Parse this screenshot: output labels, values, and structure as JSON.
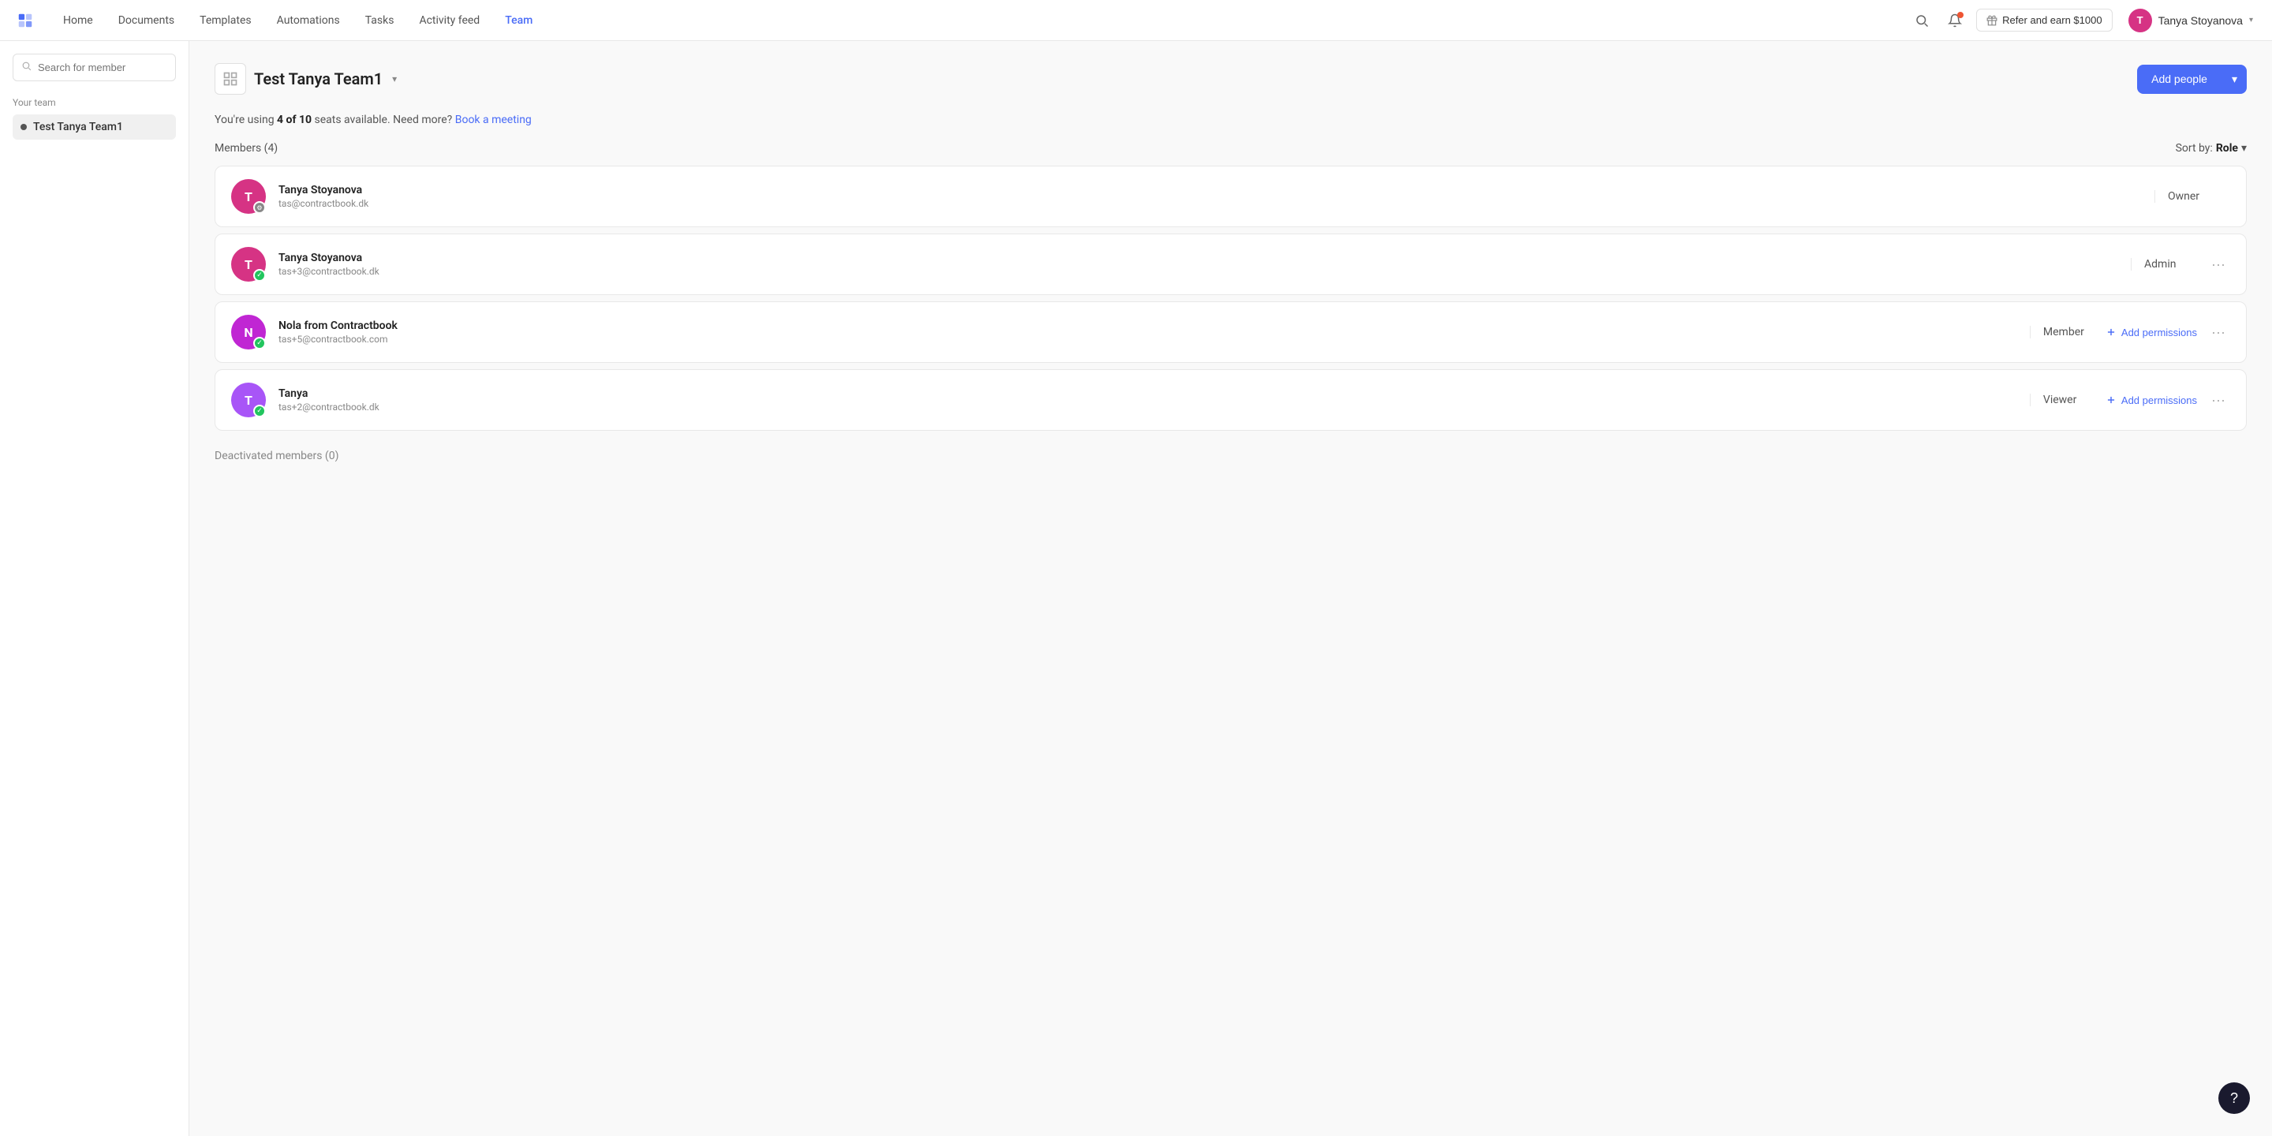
{
  "nav": {
    "links": [
      {
        "label": "Home",
        "active": false
      },
      {
        "label": "Documents",
        "active": false
      },
      {
        "label": "Templates",
        "active": false
      },
      {
        "label": "Automations",
        "active": false
      },
      {
        "label": "Tasks",
        "active": false
      },
      {
        "label": "Activity feed",
        "active": false
      },
      {
        "label": "Team",
        "active": true
      }
    ],
    "refer_label": "Refer and earn $1000",
    "user_name": "Tanya Stoyanova",
    "user_initials": "T"
  },
  "sidebar": {
    "search_placeholder": "Search for member",
    "section_label": "Your team",
    "teams": [
      {
        "label": "Test Tanya Team1",
        "active": true
      }
    ]
  },
  "main": {
    "team_name": "Test Tanya Team1",
    "add_people_label": "Add people",
    "seats_text_prefix": "You're using ",
    "seats_bold": "4 of 10",
    "seats_text_suffix": " seats available. Need more?",
    "book_meeting_label": "Book a meeting",
    "members_label": "Members (4)",
    "sort_prefix": "Sort by: ",
    "sort_value": "Role",
    "members": [
      {
        "name": "Tanya Stoyanova",
        "email": "tas@contractbook.dk",
        "role": "Owner",
        "initials": "T",
        "avatar_color": "#d63384",
        "badge_type": "shield",
        "show_actions": false
      },
      {
        "name": "Tanya Stoyanova",
        "email": "tas+3@contractbook.dk",
        "role": "Admin",
        "initials": "T",
        "avatar_color": "#d63384",
        "badge_type": "check",
        "show_actions": true,
        "show_add_perm": false
      },
      {
        "name": "Nola from Contractbook",
        "email": "tas+5@contractbook.com",
        "role": "Member",
        "initials": "N",
        "avatar_color": "#c026d3",
        "badge_type": "check",
        "show_actions": true,
        "show_add_perm": true,
        "add_perm_label": "Add permissions"
      },
      {
        "name": "Tanya",
        "email": "tas+2@contractbook.dk",
        "role": "Viewer",
        "initials": "T",
        "avatar_color": "#a855f7",
        "badge_type": "check",
        "show_actions": true,
        "show_add_perm": true,
        "add_perm_label": "Add permissions"
      }
    ],
    "deactivated_label": "Deactivated members (0)"
  }
}
